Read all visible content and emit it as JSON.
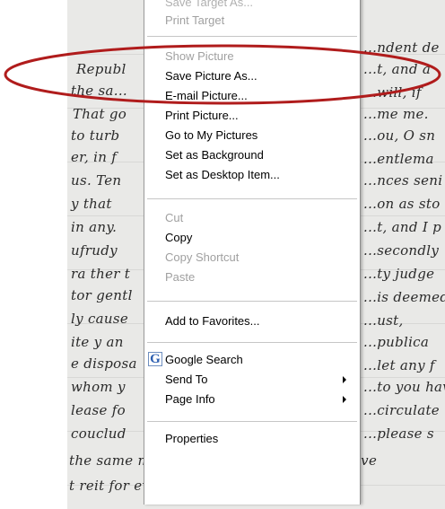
{
  "background_letter": {
    "lines": [
      "...ndent de",
      "Republ",
      "...t, and a",
      "the sa...",
      "...will, if",
      "That go",
      "...me me.",
      "to turb",
      "...ou, O sn",
      "er, in f",
      "...entlema",
      "us. Ten",
      "...nces seni",
      "y that",
      "...on as sto",
      "in any.",
      "...t, and I p",
      "ufrudy",
      "...secondly",
      "ra ther t",
      "...ty judge",
      "tor gentl",
      "...is deemed p",
      "ly cause",
      "...ust,",
      "ite y an",
      "...publica",
      "e disposa",
      "...let any f",
      "whom y",
      "...to you hav",
      "lease fo",
      "...circulate",
      "couclud",
      "...please s",
      "the same means through which you receive",
      "t reit for ever in silence and darkness."
    ]
  },
  "context_menu": {
    "items": [
      {
        "label": "Save Target As...",
        "enabled": true
      },
      {
        "label": "Print Target",
        "enabled": false
      },
      {
        "type": "separator"
      },
      {
        "label": "Show Picture",
        "enabled": false
      },
      {
        "label": "Save Picture As...",
        "enabled": true
      },
      {
        "label": "E-mail Picture...",
        "enabled": true
      },
      {
        "label": "Print Picture...",
        "enabled": true
      },
      {
        "label": "Go to My Pictures",
        "enabled": true
      },
      {
        "label": "Set as Background",
        "enabled": true
      },
      {
        "label": "Set as Desktop Item...",
        "enabled": true
      },
      {
        "type": "separator"
      },
      {
        "label": "Cut",
        "enabled": false
      },
      {
        "label": "Copy",
        "enabled": true
      },
      {
        "label": "Copy Shortcut",
        "enabled": false
      },
      {
        "label": "Paste",
        "enabled": false
      },
      {
        "type": "separator"
      },
      {
        "label": "Add to Favorites...",
        "enabled": true
      },
      {
        "type": "separator"
      },
      {
        "label": "Google Search",
        "enabled": true,
        "icon": "google-g-icon"
      },
      {
        "label": "Send To",
        "enabled": true,
        "submenu": true
      },
      {
        "label": "Page Info",
        "enabled": true,
        "submenu": true
      },
      {
        "type": "separator"
      },
      {
        "label": "Properties",
        "enabled": true
      }
    ]
  },
  "annotation": {
    "shape": "ellipse",
    "color": "#b01c1c",
    "target": "Save Picture As..."
  },
  "colors": {
    "menu_disabled_text": "#a0a0a0",
    "menu_separator": "#c6c6c6",
    "paper": "#e9e9e7"
  }
}
